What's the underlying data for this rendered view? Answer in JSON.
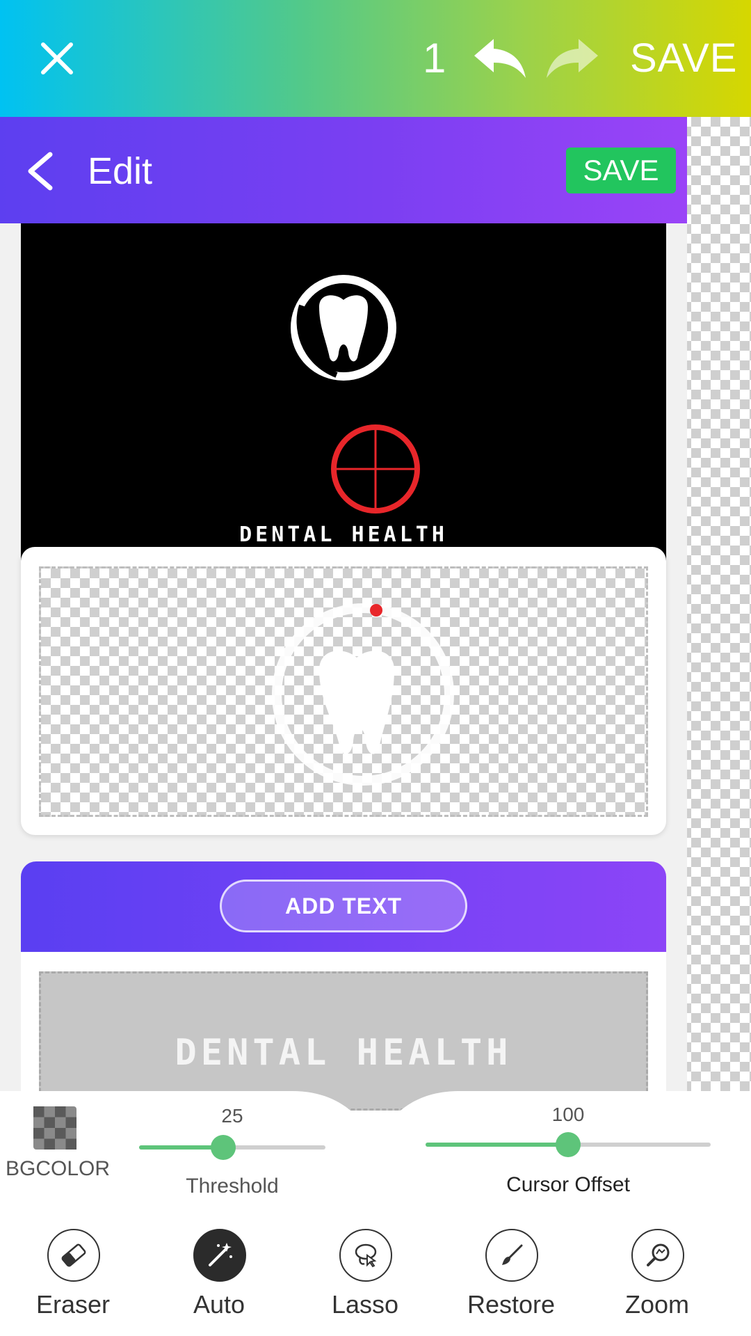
{
  "topbar": {
    "close_icon": "close-icon",
    "step_count": "1",
    "undo_icon": "undo-icon",
    "redo_icon": "redo-icon",
    "save_label": "SAVE"
  },
  "inner_app": {
    "header": {
      "back_icon": "chevron-left-icon",
      "title": "Edit",
      "save_label": "SAVE",
      "save_color": "#22c55e"
    },
    "logo_card": {
      "emblem_icon": "tooth-icon",
      "brand_text": "DENTAL HEALTH"
    },
    "text_card": {
      "add_text_label": "ADD TEXT",
      "preview_text": "DENTAL HEALTH"
    }
  },
  "panel": {
    "bgcolor_label": "BGCOLOR",
    "threshold": {
      "label": "Threshold",
      "value": "25",
      "fraction": 0.45
    },
    "cursor_offset": {
      "label": "Cursor Offset",
      "value": "100",
      "fraction": 0.5
    }
  },
  "tools": [
    {
      "label": "Eraser",
      "icon": "eraser-icon",
      "active": false
    },
    {
      "label": "Auto",
      "icon": "magic-wand-icon",
      "active": true
    },
    {
      "label": "Lasso",
      "icon": "lasso-icon",
      "active": false
    },
    {
      "label": "Restore",
      "icon": "brush-icon",
      "active": false
    },
    {
      "label": "Zoom",
      "icon": "zoom-icon",
      "active": false
    }
  ],
  "colors": {
    "accent_green": "#5ec47a",
    "cursor_red": "#e8262a",
    "header_purple": "#7b3ff2"
  }
}
